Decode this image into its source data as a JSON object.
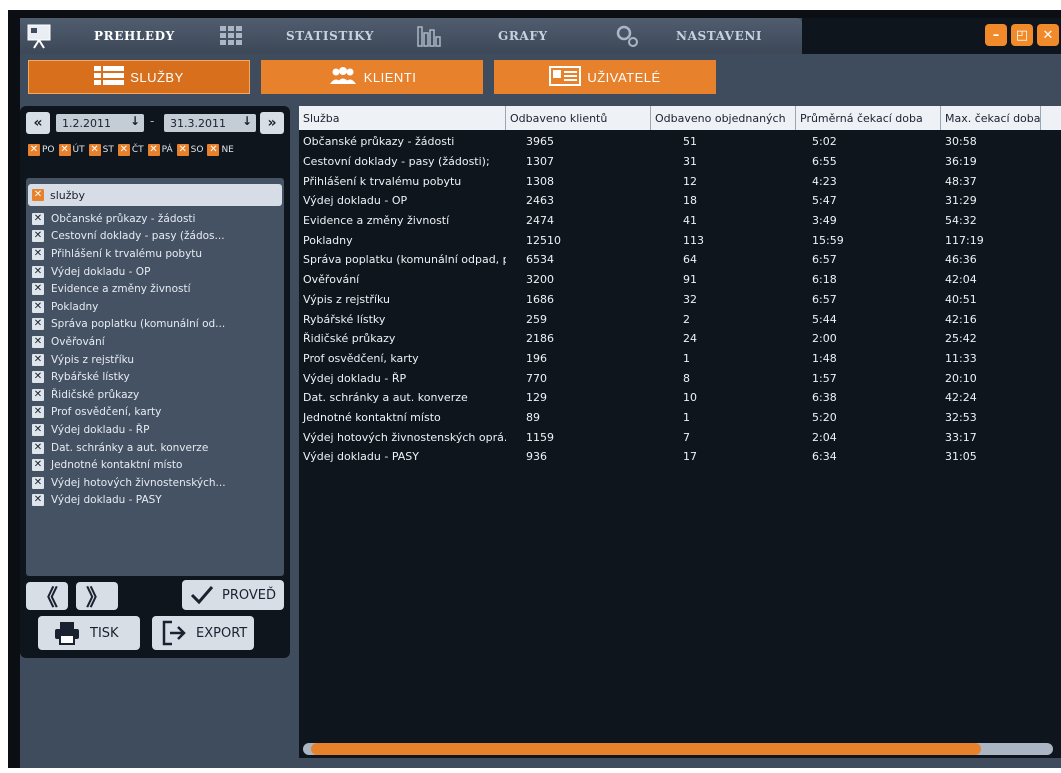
{
  "nav": {
    "items": [
      {
        "label": "PREHLEDY"
      },
      {
        "label": "STATISTIKY"
      },
      {
        "label": "GRAFY"
      },
      {
        "label": "NASTAVENI"
      }
    ]
  },
  "window": {
    "minimize": "–",
    "restore": "◰",
    "close": "✕"
  },
  "categories": [
    {
      "label": "SLUŽBY"
    },
    {
      "label": "KLIENTI"
    },
    {
      "label": "UŽIVATELÉ"
    }
  ],
  "filter": {
    "date_from": "1.2.2011",
    "separator": "-",
    "date_to": "31.3.2011",
    "days": [
      "PO",
      "ÚT",
      "ST",
      "ČT",
      "PÁ",
      "SO",
      "NE"
    ],
    "all_label": "služby",
    "services": [
      "Občanské průkazy - žádosti",
      "Cestovní doklady - pasy (žádos...",
      "Přihlášení k trvalému pobytu",
      "Výdej dokladu - OP",
      "Evidence a změny živností",
      "Pokladny",
      "Správa poplatku (komunální od...",
      "Ověřování",
      "Výpis z rejstříku",
      "Rybářské lístky",
      "Řidičské průkazy",
      "Prof osvědčení, karty",
      "Výdej dokladu - ŘP",
      "Dat. schránky a aut. konverze",
      "Jednotné kontaktní místo",
      "Výdej hotových živnostenských...",
      "Výdej dokladu - PASY"
    ]
  },
  "buttons": {
    "prev": "《",
    "next": "》",
    "run": "PROVEĎ",
    "print": "TISK",
    "export": "EXPORT"
  },
  "table": {
    "columns": [
      "Služba",
      "Odbaveno klientů",
      "Odbaveno objednaných",
      "Průměrná čekací doba",
      "Max. čekací doba"
    ],
    "rows": [
      [
        "Občanské průkazy - žádosti",
        "3965",
        "51",
        "5:02",
        "30:58"
      ],
      [
        "Cestovní doklady - pasy (žádosti);",
        "1307",
        "31",
        "6:55",
        "36:19"
      ],
      [
        "Přihlášení k trvalému pobytu",
        "1308",
        "12",
        "4:23",
        "48:37"
      ],
      [
        "Výdej dokladu - OP",
        "2463",
        "18",
        "5:47",
        "31:29"
      ],
      [
        "Evidence a změny živností",
        "2474",
        "41",
        "3:49",
        "54:32"
      ],
      [
        "Pokladny",
        "12510",
        "113",
        "15:59",
        "117:19"
      ],
      [
        "Správa poplatku (komunální odpad, psi)",
        "6534",
        "64",
        "6:57",
        "46:36"
      ],
      [
        "Ověřování",
        "3200",
        "91",
        "6:18",
        "42:04"
      ],
      [
        "Výpis z rejstříku",
        "1686",
        "32",
        "6:57",
        "40:51"
      ],
      [
        "Rybářské lístky",
        "259",
        "2",
        "5:44",
        "42:16"
      ],
      [
        "Řidičské průkazy",
        "2186",
        "24",
        "2:00",
        "25:42"
      ],
      [
        "Prof osvědčení, karty",
        "196",
        "1",
        "1:48",
        "11:33"
      ],
      [
        "Výdej dokladu - ŘP",
        "770",
        "8",
        "1:57",
        "20:10"
      ],
      [
        "Dat. schránky a aut. konverze",
        "129",
        "10",
        "6:38",
        "42:24"
      ],
      [
        "Jednotné kontaktní místo",
        "89",
        "1",
        "5:20",
        "32:53"
      ],
      [
        "Výdej hotových živnostenských oprá...",
        "1159",
        "7",
        "2:04",
        "33:17"
      ],
      [
        "Výdej dokladu - PASY",
        "936",
        "17",
        "6:34",
        "31:05"
      ]
    ]
  },
  "colors": {
    "accent": "#e8812c",
    "panel": "#0f151d",
    "background": "#3f4c5d"
  }
}
